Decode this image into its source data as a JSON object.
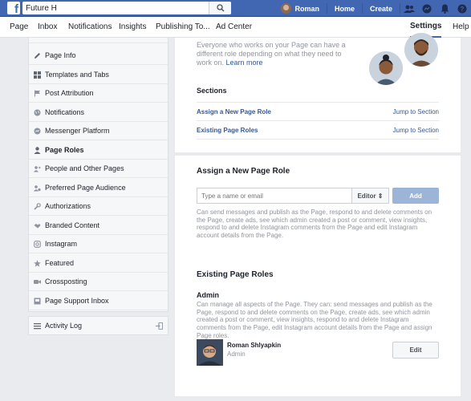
{
  "topbar": {
    "search_value": "Future H",
    "user_name": "Roman",
    "home_label": "Home",
    "create_label": "Create"
  },
  "page_nav": {
    "items": [
      "Page",
      "Inbox",
      "Notifications",
      "Insights",
      "Publishing To...",
      "Ad Center"
    ],
    "settings_label": "Settings",
    "help_label": "Help ▾"
  },
  "sidebar": {
    "items": [
      {
        "label": "Page Info",
        "icon": "pencil-icon"
      },
      {
        "label": "Templates and Tabs",
        "icon": "grid-icon"
      },
      {
        "label": "Post Attribution",
        "icon": "flag-icon"
      },
      {
        "label": "Notifications",
        "icon": "globe-icon"
      },
      {
        "label": "Messenger Platform",
        "icon": "messenger-icon"
      },
      {
        "label": "Page Roles",
        "icon": "person-icon"
      },
      {
        "label": "People and Other Pages",
        "icon": "people-icon"
      },
      {
        "label": "Preferred Page Audience",
        "icon": "audience-icon"
      },
      {
        "label": "Authorizations",
        "icon": "wrench-icon"
      },
      {
        "label": "Branded Content",
        "icon": "handshake-icon"
      },
      {
        "label": "Instagram",
        "icon": "instagram-icon"
      },
      {
        "label": "Featured",
        "icon": "star-icon"
      },
      {
        "label": "Crossposting",
        "icon": "video-icon"
      },
      {
        "label": "Page Support Inbox",
        "icon": "inbox-icon"
      }
    ],
    "active_index": 5,
    "activity_log": "Activity Log"
  },
  "intro": {
    "text": "Everyone who works on your Page can have a different role depending on what they need to work on.",
    "link": "Learn more"
  },
  "sections": {
    "title": "Sections",
    "rows": [
      {
        "label": "Assign a New Page Role",
        "jump": "Jump to Section"
      },
      {
        "label": "Existing Page Roles",
        "jump": "Jump to Section"
      }
    ]
  },
  "assign": {
    "title": "Assign a New Page Role",
    "input_placeholder": "Type a name or email",
    "role_select": "Editor ⇕",
    "add_label": "Add",
    "description": "Can send messages and publish as the Page, respond to and delete comments on the Page, create ads, see which admin created a post or comment, view insights, respond to and delete Instagram comments from the Page and edit Instagram account details from the Page."
  },
  "existing": {
    "title": "Existing Page Roles",
    "admin_label": "Admin",
    "admin_description": "Can manage all aspects of the Page. They can: send messages and publish as the Page, respond to and delete comments on the Page, create ads, see which admin created a post or comment, view insights, respond to and delete Instagram comments from the Page, edit Instagram account details from the Page and assign Page roles.",
    "user": {
      "name": "Roman Shlyapkin",
      "role": "Admin"
    },
    "edit_label": "Edit"
  },
  "colors": {
    "brand": "#4267b2",
    "link": "#365899",
    "add_button": "#9cb4d8"
  }
}
